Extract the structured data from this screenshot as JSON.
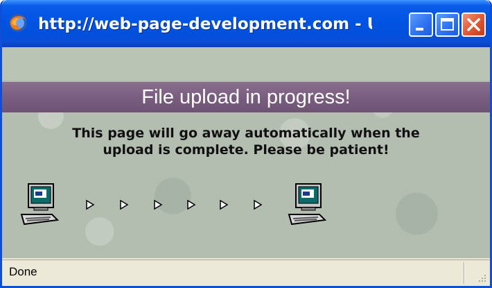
{
  "window": {
    "title": "http://web-page-development.com - U...",
    "title_icon": "firefox-icon",
    "controls": {
      "minimize_icon": "minimize-icon",
      "maximize_icon": "maximize-icon",
      "close_icon": "close-icon"
    }
  },
  "content": {
    "banner": "File upload in progress!",
    "message_line1": "This page will go away automatically when the",
    "message_line2": "upload is complete. Please be patient!",
    "progress": {
      "source_icon": "computer-icon",
      "destination_icon": "computer-icon",
      "arrow_icon": "triangle-right-icon",
      "arrow_count": 6
    }
  },
  "statusbar": {
    "text": "Done"
  },
  "colors": {
    "titlebar": "#0054e3",
    "banner": "#7a5e80",
    "content_bg": "#b3beb1",
    "close_button": "#e25a36"
  }
}
